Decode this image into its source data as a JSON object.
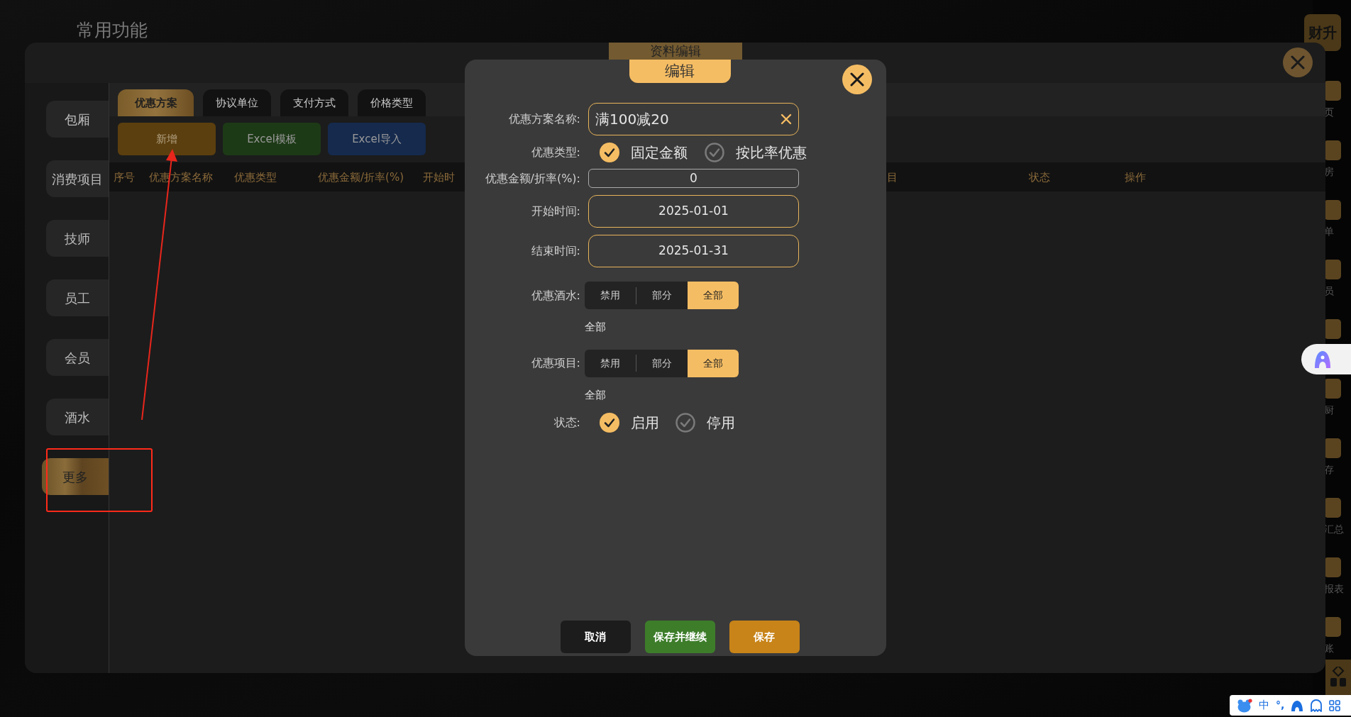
{
  "page_title": "常用功能",
  "app_logo": "财升",
  "nav_items": [
    {
      "kind": "labeled",
      "label": "页"
    },
    {
      "kind": "labeled",
      "label": "房"
    },
    {
      "kind": "labeled",
      "label": "单"
    },
    {
      "kind": "labeled",
      "label": "员"
    },
    {
      "kind": "icon_only"
    },
    {
      "kind": "labeled",
      "label": "厨"
    },
    {
      "kind": "labeled",
      "label": "存"
    },
    {
      "kind": "labeled",
      "label": "汇总"
    },
    {
      "kind": "labeled",
      "label": "报表"
    },
    {
      "kind": "labeled",
      "label": "账"
    }
  ],
  "modal": {
    "title": "资料编辑",
    "sidebar": [
      {
        "label": "包厢",
        "selected": false
      },
      {
        "label": "消费项目",
        "selected": false
      },
      {
        "label": "技师",
        "selected": false
      },
      {
        "label": "员工",
        "selected": false
      },
      {
        "label": "会员",
        "selected": false
      },
      {
        "label": "酒水",
        "selected": false
      },
      {
        "label": "更多",
        "selected": true
      }
    ],
    "tabs": [
      {
        "label": "优惠方案",
        "selected": true
      },
      {
        "label": "协议单位",
        "selected": false
      },
      {
        "label": "支付方式",
        "selected": false
      },
      {
        "label": "价格类型",
        "selected": false
      }
    ],
    "actions": [
      {
        "label": "新增",
        "kind": "add"
      },
      {
        "label": "Excel模板",
        "kind": "template"
      },
      {
        "label": "Excel导入",
        "kind": "import"
      }
    ],
    "table": {
      "columns": [
        "序号",
        "优惠方案名称",
        "优惠类型",
        "优惠金额/折率(%)",
        "开始时",
        "目",
        "状态",
        "操作"
      ]
    }
  },
  "dialog": {
    "title": "编辑",
    "fields": [
      {
        "kind": "text",
        "label": "优惠方案名称:",
        "value": "满100减20"
      },
      {
        "kind": "radio",
        "label": "优惠类型:",
        "options": [
          {
            "label": "固定金额",
            "selected": true
          },
          {
            "label": "按比率优惠",
            "selected": false
          }
        ]
      },
      {
        "kind": "input",
        "label": "优惠金额/折率(%):",
        "value": "0"
      },
      {
        "kind": "date",
        "label": "开始时间:",
        "value": "2025-01-01"
      },
      {
        "kind": "date",
        "label": "结束时间:",
        "value": "2025-01-31"
      },
      {
        "kind": "segmented",
        "label": "优惠酒水:",
        "options": [
          {
            "label": "禁用",
            "selected": false
          },
          {
            "label": "部分",
            "selected": false
          },
          {
            "label": "全部",
            "selected": true
          }
        ],
        "summary": "全部"
      },
      {
        "kind": "segmented",
        "label": "优惠项目:",
        "options": [
          {
            "label": "禁用",
            "selected": false
          },
          {
            "label": "部分",
            "selected": false
          },
          {
            "label": "全部",
            "selected": true
          }
        ],
        "summary": "全部"
      },
      {
        "kind": "status",
        "label": "状态:",
        "options": [
          {
            "label": "启用",
            "selected": true
          },
          {
            "label": "停用",
            "selected": false
          }
        ]
      }
    ],
    "buttons": [
      {
        "label": "取消",
        "kind": "cancel"
      },
      {
        "label": "保存并继续",
        "kind": "continue"
      },
      {
        "label": "保存",
        "kind": "save"
      }
    ]
  },
  "ime_bar": {
    "language": "中",
    "punctuation": "°,"
  }
}
